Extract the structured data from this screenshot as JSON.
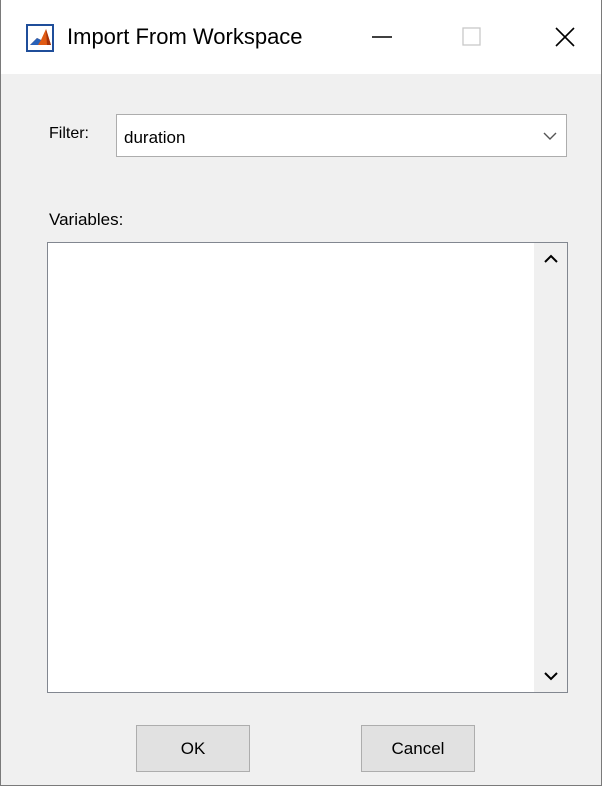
{
  "window": {
    "title": "Import From Workspace",
    "icon": "matlab-logo-icon",
    "controls": [
      "minimize-icon",
      "maximize-icon",
      "close-icon"
    ]
  },
  "filter": {
    "label": "Filter:",
    "selected_value": "duration"
  },
  "variables": {
    "label": "Variables:",
    "items": []
  },
  "buttons": {
    "ok_label": "OK",
    "cancel_label": "Cancel"
  },
  "colors": {
    "window_bg": "#f0f0f0",
    "titlebar_bg": "#ffffff",
    "button_bg": "#e1e1e1",
    "border": "#adadad"
  }
}
